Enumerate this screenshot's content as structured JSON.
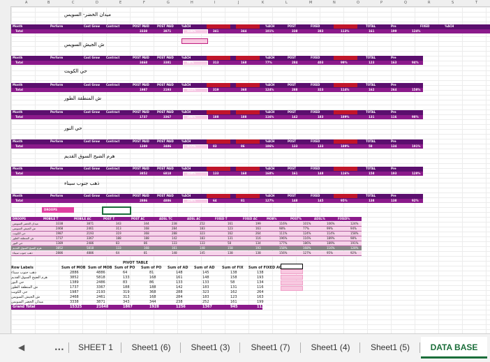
{
  "sheet": {
    "section_titles": [
      "ميدان الخضر- السويس",
      "ش الجيش السويس",
      "حي الكويت",
      "ش المنطقة الطور",
      "حي النور",
      "هرم الضيح السوق القديم",
      "ذهب جنوب سيناء"
    ],
    "header_labels": [
      "Month",
      "Perform",
      "Cost Grow",
      "Contract",
      "POST PAID",
      "POST PAID",
      "%ACH",
      "Post TC",
      "Post AC",
      "%ACH",
      "POST",
      "FIXED",
      "%ACH",
      "TOTAL",
      "Pre",
      "FIXED",
      "%ACH"
    ],
    "total_label": "Total",
    "row_values": [
      [
        "3338",
        "3871",
        "116%",
        "341",
        "344",
        "101%",
        "338",
        "383",
        "113%",
        "161",
        "199",
        "124%"
      ],
      [
        "3468",
        "3381",
        "98%",
        "313",
        "168",
        "77%",
        "284",
        "403",
        "99%",
        "123",
        "163",
        "94%"
      ],
      [
        "1987",
        "2193",
        "111%",
        "319",
        "368",
        "124%",
        "288",
        "323",
        "114%",
        "162",
        "264",
        "158%"
      ],
      [
        "1737",
        "3367",
        "196%",
        "188",
        "188",
        "116%",
        "142",
        "183",
        "189%",
        "131",
        "116",
        "98%"
      ],
      [
        "1389",
        "3486",
        "177%",
        "83",
        "86",
        "186%",
        "133",
        "133",
        "189%",
        "58",
        "134",
        "191%"
      ],
      [
        "3852",
        "6818",
        "158%",
        "133",
        "168",
        "168%",
        "161",
        "148",
        "116%",
        "158",
        "193",
        "128%"
      ],
      [
        "2886",
        "4886",
        "156%",
        "64",
        "81",
        "127%",
        "148",
        "145",
        "95%",
        "138",
        "138",
        "92%"
      ]
    ],
    "droops_label": "DROOPS",
    "table": {
      "headers": [
        "DROOPS",
        "MOBILE T",
        "MOBILE AC",
        "POST T",
        "POST AC",
        "ADSL TC",
        "ADSL AC",
        "FIXED T",
        "FIXED AC",
        "MOB%",
        "POST%",
        "ADSL%",
        "FIXED%"
      ],
      "rows": [
        [
          "ميدان الخضر السويس",
          "3338",
          "3871",
          "343",
          "344",
          "238",
          "252",
          "161",
          "199",
          "116%",
          "101%",
          "106%",
          "124%"
        ],
        [
          "ش الجيش السويس",
          "2468",
          "2461",
          "313",
          "168",
          "284",
          "183",
          "123",
          "163",
          "98%",
          "77%",
          "99%",
          "94%"
        ],
        [
          "حي الكويت",
          "1987",
          "2193",
          "319",
          "368",
          "288",
          "323",
          "162",
          "264",
          "111%",
          "124%",
          "114%",
          "158%"
        ],
        [
          "ش المنطقة الطور",
          "1737",
          "3367",
          "188",
          "188",
          "142",
          "183",
          "131",
          "116",
          "196%",
          "116%",
          "189%",
          "98%"
        ],
        [
          "حي النور",
          "1389",
          "2486",
          "83",
          "86",
          "133",
          "133",
          "58",
          "134",
          "177%",
          "186%",
          "189%",
          "191%"
        ],
        [
          "هرم الضيح السوق القديم",
          "3852",
          "5818",
          "133",
          "168",
          "161",
          "148",
          "158",
          "193",
          "158%",
          "168%",
          "116%",
          "128%"
        ],
        [
          "ذهب جنوب سيناء",
          "2886",
          "4886",
          "64",
          "81",
          "148",
          "145",
          "138",
          "138",
          "156%",
          "127%",
          "95%",
          "92%"
        ]
      ]
    },
    "pivot": {
      "title": "PIVOT TABLE",
      "headers": [
        "Row Labels",
        "Sum of MOB",
        "Sum of MOB",
        "Sum of PO",
        "Sum of PO",
        "Sum of AD",
        "Sum of AD",
        "Sum of FIX",
        "Sum of FIXED ACH"
      ],
      "rows": [
        [
          "ذهب جنوب سيناء",
          "2886",
          "4886",
          "64",
          "81",
          "148",
          "145",
          "138",
          "138"
        ],
        [
          "هرم الضيح السوق القديم",
          "3852",
          "5818",
          "133",
          "168",
          "161",
          "148",
          "158",
          "193"
        ],
        [
          "حي النور",
          "1389",
          "2486",
          "83",
          "86",
          "133",
          "133",
          "58",
          "134"
        ],
        [
          "ش المنطقة الطور",
          "1737",
          "3367",
          "188",
          "188",
          "142",
          "183",
          "131",
          "116"
        ],
        [
          "حي الكويت",
          "1987",
          "2193",
          "319",
          "368",
          "288",
          "323",
          "162",
          "264"
        ],
        [
          "ش الجيش السويس",
          "2468",
          "2461",
          "313",
          "168",
          "284",
          "183",
          "123",
          "163"
        ],
        [
          "ميدان الخضر السويس",
          "3338",
          "3871",
          "343",
          "344",
          "238",
          "252",
          "161",
          "199"
        ]
      ],
      "grand_total": [
        "Grand Total",
        "15325",
        "21648",
        "1867",
        "1928",
        "1256",
        "1367",
        "945",
        "1122"
      ]
    }
  },
  "tabs": {
    "prev": "◀",
    "more": "...",
    "items": [
      "SHEET 1",
      "Sheet1 (6)",
      "Sheet1 (3)",
      "Sheet1 (7)",
      "Sheet1 (4)",
      "Sheet1 (5)",
      "DATA BASE"
    ],
    "active": "DATA BASE"
  }
}
